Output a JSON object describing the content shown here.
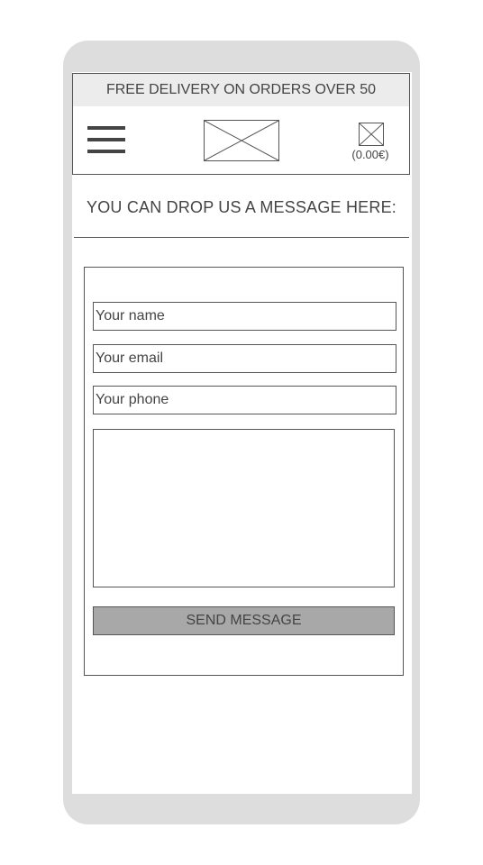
{
  "promo": {
    "text": "FREE DELIVERY ON ORDERS OVER 50"
  },
  "header": {
    "menu_icon": "hamburger-menu-icon",
    "logo_icon": "image-placeholder-icon",
    "cart_icon": "image-placeholder-icon",
    "cart_total": "(0.00€)"
  },
  "page": {
    "heading": "YOU CAN DROP US A MESSAGE HERE:"
  },
  "form": {
    "name_placeholder": "Your name",
    "email_placeholder": "Your email",
    "phone_placeholder": "Your phone",
    "message_value": "",
    "send_label": "SEND MESSAGE"
  },
  "colors": {
    "device_frame": "#dddddd",
    "promo_background": "#ececec",
    "button_background": "#a8a8a8",
    "text": "#444444",
    "border": "#555555"
  }
}
